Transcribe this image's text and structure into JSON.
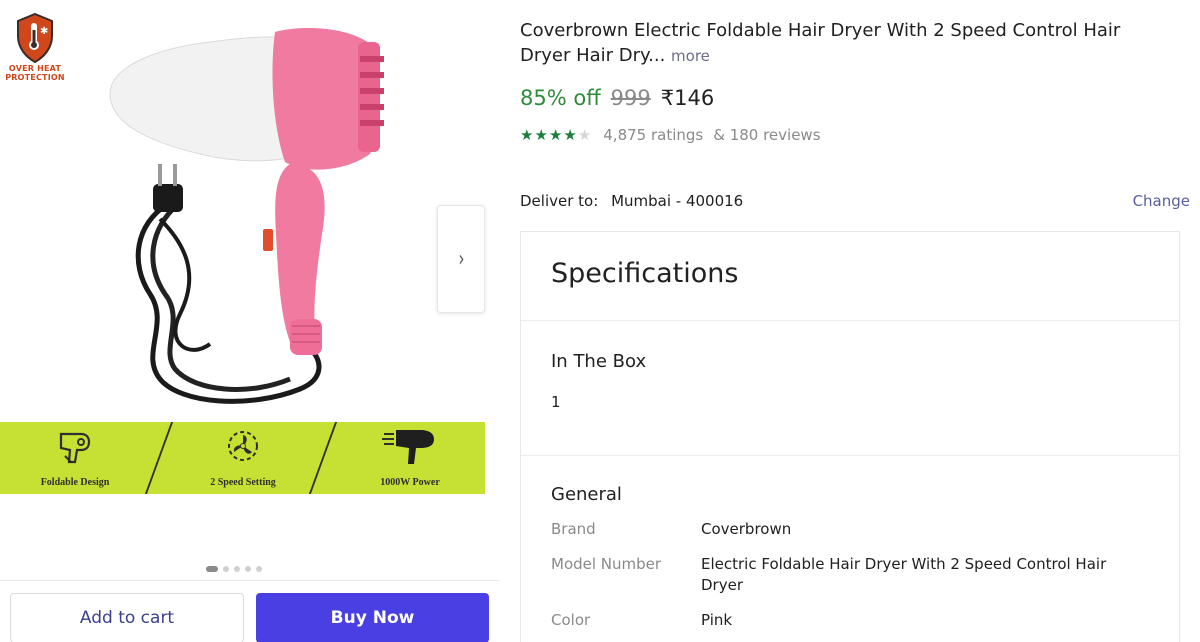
{
  "badge": {
    "label_line1": "OVER HEAT",
    "label_line2": "PROTECTION"
  },
  "features": [
    {
      "label": "Foldable Design"
    },
    {
      "label": "2 Speed Setting"
    },
    {
      "label": "1000W Power"
    }
  ],
  "carousel": {
    "dot_count": 5,
    "active_index": 0
  },
  "actions": {
    "add_to_cart": "Add to cart",
    "buy_now": "Buy Now"
  },
  "product": {
    "title": "Coverbrown Electric Foldable Hair Dryer With 2 Speed Control Hair Dryer Hair Dry...",
    "more_label": "more",
    "discount": "85% off",
    "mrp": "999",
    "price": "₹146",
    "rating_stars": 4,
    "ratings_text": "4,875 ratings",
    "reviews_text": "& 180 reviews"
  },
  "delivery": {
    "label": "Deliver to:",
    "location": "Mumbai - 400016",
    "change_label": "Change"
  },
  "specs": {
    "heading": "Specifications",
    "in_the_box": {
      "title": "In The Box",
      "value": "1"
    },
    "general": {
      "title": "General",
      "rows": [
        {
          "key": "Brand",
          "value": "Coverbrown"
        },
        {
          "key": "Model Number",
          "value": "Electric Foldable Hair Dryer With 2 Speed Control Hair Dryer"
        },
        {
          "key": "Color",
          "value": "Pink"
        }
      ]
    }
  },
  "colors": {
    "accent": "#4a3fe2",
    "discount": "#2e8b3a",
    "rating": "#1a7f3a",
    "feature_strip": "#c6e133",
    "badge": "#d0471b"
  }
}
